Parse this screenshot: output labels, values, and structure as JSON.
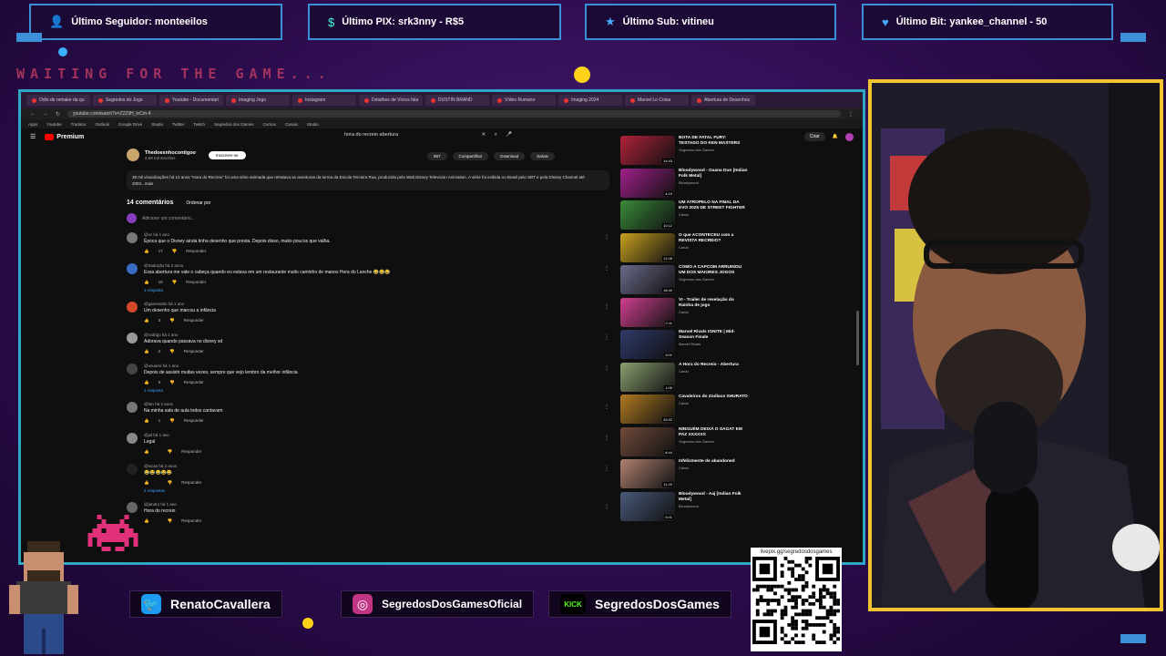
{
  "top_alerts": [
    {
      "icon": "follower-icon",
      "glyph": "👤",
      "label": "Último Seguidor: monteeilos"
    },
    {
      "icon": "pix-icon",
      "glyph": "$",
      "label": "Último PIX: srk3nny - R$5"
    },
    {
      "icon": "star-icon",
      "glyph": "★",
      "label": "Último Sub: vitineu"
    },
    {
      "icon": "heart-icon",
      "glyph": "♥",
      "label": "Último Bit: yankee_channel - 50"
    }
  ],
  "waiting_text": "WAITING FOR THE GAME...",
  "browser": {
    "address": "youtube.com/watch?v=Z2Z9H_tvCm-4",
    "tabs": [
      "Odio de remake da qu",
      "Segredos do Jogo",
      "Youtube - Documentari",
      "Imaging Jogo",
      "Instagram",
      "Detalhes de Vícios fala",
      "DUSTIN BRAND",
      "Vídeo Rumano",
      "Imaging 2024",
      "Marvel Lo Coisa",
      "Abertura de Desenhos"
    ],
    "bookmarks": [
      "Apps",
      "Youtube",
      "Tradutor",
      "Outlook",
      "Google Drive",
      "Studio",
      "Twitter",
      "Twitch",
      "Segredos dos Games",
      "Cursos",
      "Canais",
      "Studio"
    ],
    "yt_brand": "Premium",
    "search_query": "hora do recreio abertura",
    "create_label": "Criar",
    "channel_name": "Thedoesnhocontigoo",
    "channel_subs": "2,69 mil inscritos",
    "subscribe_label": "Inscrever-se",
    "actions": [
      "887",
      "Compartilhar",
      "Download",
      "Salvar"
    ],
    "description": "39 mil visualizações há 12 anos\n\"Hora do Recreio\" foi uma série animada que retratava as aventuras da turma da Escola Terceira Rua, produzida pela Walt Disney Television Animation. A série foi exibida no Brasil pelo SBT e pela Disney Channel até 2003...mais",
    "comment_count": "14 comentários",
    "sort_label": "Ordenar por",
    "add_comment": "Adicione um comentário...",
    "comments": [
      {
        "author": "@vc há 1 ano",
        "text": "Época que o Disney ainda tinha desenho que presta. Depois disso, muito poucos que valha.",
        "likes": "17",
        "reply": "Responder",
        "color": "#777",
        "replies": ""
      },
      {
        "author": "@tradução há 2 anos",
        "text": "Essa abertura me vale o cabeça quando eu estava em um restaurante muito caminho de manos Hora do Lanche 😂😂😂",
        "likes": "16",
        "reply": "Responder",
        "color": "#3a6bc4",
        "replies": "1 resposta"
      },
      {
        "author": "@gamesalto há 1 ano",
        "text": "Um desenho que marcou a infância",
        "likes": "3",
        "reply": "Responder",
        "color": "#d04a2a",
        "replies": ""
      },
      {
        "author": "@rodrigo há 1 ano",
        "text": "Adorava quando passava no disney xd",
        "likes": "2",
        "reply": "Responder",
        "color": "#9a9a9a",
        "replies": ""
      },
      {
        "author": "@usuario há 1 ano",
        "text": "Depois de assistir muitas vezes, sempre que vejo lembro da melhor infância",
        "likes": "5",
        "reply": "Responder",
        "color": "#444",
        "replies": "1 resposta"
      },
      {
        "author": "@fan há 2 anos",
        "text": "Na minha sala de aula todos cantavam",
        "likes": "1",
        "reply": "Responder",
        "color": "#777",
        "replies": ""
      },
      {
        "author": "@jul há 1 ano",
        "text": "Legal",
        "likes": "",
        "reply": "Responder",
        "color": "#888",
        "replies": ""
      },
      {
        "author": "@lucas há 2 anos",
        "text": "😂😂😂😂😂",
        "likes": "",
        "reply": "Responder",
        "color": "#222",
        "replies": "2 respostas"
      },
      {
        "author": "@jandro há 1 ano",
        "text": "Hora do recreio",
        "likes": "",
        "reply": "Responder",
        "color": "#666",
        "replies": ""
      }
    ],
    "recommendations": [
      {
        "title": "BOTA DE FATAL FURY: TESTADO DO KEN MASTERS",
        "channel": "Segredos dos Games",
        "color": "#b0223a",
        "dur": "14:43"
      },
      {
        "title": "Bloodywood - Gaana Dun [Indian Folk Metal]",
        "channel": "Bloodywood",
        "color": "#a0208a",
        "dur": "4:19"
      },
      {
        "title": "UM ATROPELO NA FINAL DA EVO 2025 DE STREET FIGHTER",
        "channel": "Canal",
        "color": "#3a8a3a",
        "dur": "10:12"
      },
      {
        "title": "O que ACONTECEU com a REVISTA RECREIO?",
        "channel": "Canal",
        "color": "#c8a020",
        "dur": "12:08"
      },
      {
        "title": "COMO A CAPCOM ARRUINOU UM DOS MAIORES JOGOS",
        "channel": "Segredos dos Games",
        "color": "#6a6a8a",
        "dur": "18:40"
      },
      {
        "title": "VI - Trailer de revelação do Rainha de jogo",
        "channel": "Canal",
        "color": "#d04090",
        "dur": "2:11"
      },
      {
        "title": "Marvel Rivals IGNITE | Mid-Season Finale",
        "channel": "Marvel Rivals",
        "color": "#303a6a",
        "dur": "3:02"
      },
      {
        "title": "A Hora do Recreio - Abertura",
        "channel": "Canal",
        "color": "#8aa070",
        "dur": "1:06"
      },
      {
        "title": "Cavaleiros do Zodíaco SHURATO",
        "channel": "Canal",
        "color": "#b07a20",
        "dur": "25:32"
      },
      {
        "title": "NINGUÉM DEIXA O SAGAT EM PAZ XXXXXX",
        "channel": "Segredos dos Games",
        "color": "#704a3a",
        "dur": "8:44"
      },
      {
        "title": "Infelizmente de abandoned",
        "channel": "Canal",
        "color": "#b08070",
        "dur": "11:20"
      },
      {
        "title": "Bloodywood - Aaj [Indian Folk Metal]",
        "channel": "Bloodywood",
        "color": "#4a5a7a",
        "dur": "5:01"
      }
    ]
  },
  "socials": [
    {
      "icon": "twitter-icon",
      "glyph": "🐦",
      "label": "RenatoCavallera",
      "color": "#1d9bf0"
    },
    {
      "icon": "instagram-icon",
      "glyph": "◎",
      "label": "SegredosDosGamesOficial",
      "color": "#c13584"
    },
    {
      "icon": "kick-icon",
      "glyph": "KICK",
      "label": "SegredosDosGames",
      "color": "#53fc18"
    }
  ],
  "qr_url": "livepix.gg/segredosdosgames"
}
